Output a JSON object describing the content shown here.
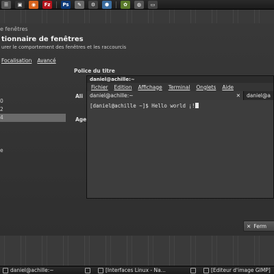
{
  "top_panel": {
    "launchers": [
      {
        "icon": "menu-icon",
        "glyph": "☰",
        "color": "#555"
      },
      {
        "icon": "terminal-icon",
        "glyph": "▣",
        "color": "#333"
      },
      {
        "icon": "firefox-icon",
        "glyph": "◉",
        "color": "#d9631c"
      },
      {
        "icon": "filezilla-icon",
        "glyph": "Fz",
        "color": "#b3141c"
      },
      {
        "icon": "photoshop-icon",
        "glyph": "Ps",
        "color": "#0d3a78"
      },
      {
        "icon": "text-editor-icon",
        "glyph": "✎",
        "color": "#6a6a6a"
      },
      {
        "icon": "settings-icon",
        "glyph": "⚙",
        "color": "#444"
      },
      {
        "icon": "cube-icon",
        "glyph": "⬢",
        "color": "#3c6ea0"
      },
      {
        "icon": "chat-icon",
        "glyph": "✿",
        "color": "#5a7a2a"
      },
      {
        "icon": "media-icon",
        "glyph": "◍",
        "color": "#555"
      },
      {
        "icon": "monitor-icon",
        "glyph": "▭",
        "color": "#444"
      }
    ]
  },
  "background_dialog": {
    "window_label": "e fenêtres",
    "title": "tionnaire de fenêtres",
    "subtitle": "urer le comportement des fenêtres et les raccourcis",
    "tabs": [
      "Focalisation",
      "Avancé"
    ],
    "left_list": [
      "",
      "0",
      "2",
      "4",
      "",
      "",
      "",
      "e"
    ],
    "selected_index": 3,
    "labels": {
      "title_font": "Police du titre",
      "align": "Ali",
      "age": "Age"
    },
    "close_button": "Ferm"
  },
  "terminal": {
    "title": "daniel@achille:~",
    "menu": [
      "Fichier",
      "Edition",
      "Affichage",
      "Terminal",
      "Onglets",
      "Aide"
    ],
    "tabs": [
      {
        "label": "daniel@achille:~",
        "close": "✕"
      },
      {
        "label": "daniel@a"
      }
    ],
    "prompt_line": "[daniel@achille ~]$ Hello world ¡!"
  },
  "taskbar": {
    "tasks": [
      {
        "label": "daniel@achille:~",
        "icon": "terminal-icon"
      },
      {
        "label": "",
        "icon": "blank-icon"
      },
      {
        "label": "[Interfaces Linux - Na...",
        "icon": "browser-icon"
      },
      {
        "label": "",
        "icon": "blank-icon"
      },
      {
        "label": "[Editeur d'image GIMP]",
        "icon": "gimp-icon"
      }
    ]
  }
}
